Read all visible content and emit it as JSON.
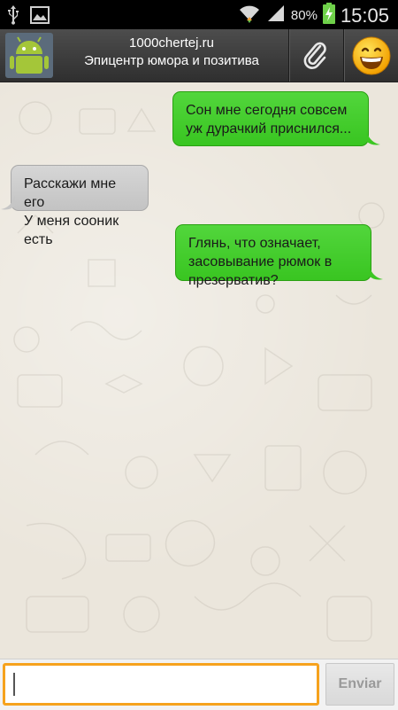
{
  "status_bar": {
    "battery_percent": "80%",
    "time": "15:05",
    "icons": [
      "usb-icon",
      "image-icon",
      "wifi-icon",
      "signal-icon",
      "battery-charging-icon"
    ]
  },
  "header": {
    "title": "1000chertej.ru",
    "subtitle": "Эпицентр юмора и позитива",
    "avatar_icon": "android-icon",
    "attach_icon": "paperclip-icon",
    "emoji_icon": "smiley-icon"
  },
  "messages": [
    {
      "direction": "outgoing",
      "text": "Сон мне сегодня совсем\nуж дурачкий приснился..."
    },
    {
      "direction": "incoming",
      "text": "Расскажи мне его\nУ меня сооник есть"
    },
    {
      "direction": "outgoing",
      "text": "Глянь, что означает,\nзасовывание рюмок в\nпрезерватив?"
    }
  ],
  "input_bar": {
    "input_value": "",
    "send_label": "Enviar"
  },
  "colors": {
    "outgoing_bubble": "#44cc2c",
    "incoming_bubble": "#cccccc",
    "input_focus": "#f6a21d"
  }
}
